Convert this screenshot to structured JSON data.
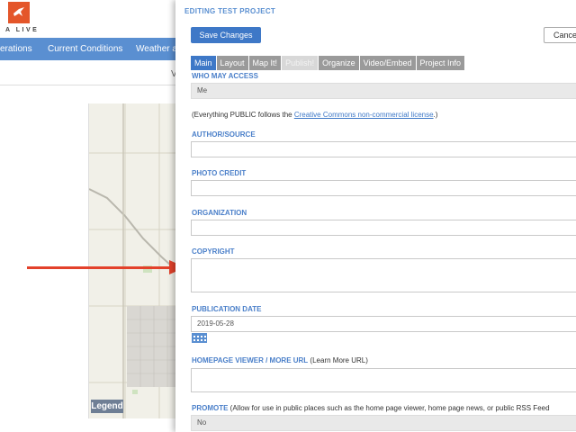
{
  "background": {
    "logo_text": "A LIVE",
    "nav": [
      "erations",
      "Current Conditions",
      "Weather a"
    ],
    "sub_text": "V",
    "legend_label": "Legend"
  },
  "panel": {
    "title": "EDITING TEST PROJECT",
    "save_label": "Save Changes",
    "cancel_label": "Cance",
    "tabs": [
      {
        "label": "Main",
        "state": "active"
      },
      {
        "label": "Layout",
        "state": "normal"
      },
      {
        "label": "Map It!",
        "state": "normal"
      },
      {
        "label": "Publish!",
        "state": "dim"
      },
      {
        "label": "Organize",
        "state": "normal"
      },
      {
        "label": "Video/Embed",
        "state": "normal"
      },
      {
        "label": "Project Info",
        "state": "normal"
      }
    ],
    "who_may_access": {
      "label": "WHO MAY ACCESS",
      "value": "Me"
    },
    "license_note": {
      "prefix": "(Everything PUBLIC follows the ",
      "link": "Creative Commons non-commercial license",
      "suffix": ".)"
    },
    "author": {
      "label": "AUTHOR/SOURCE",
      "value": ""
    },
    "photo_credit": {
      "label": "PHOTO CREDIT",
      "value": ""
    },
    "organization": {
      "label": "ORGANIZATION",
      "value": ""
    },
    "copyright": {
      "label": "COPYRIGHT",
      "value": ""
    },
    "publication_date": {
      "label": "PUBLICATION DATE",
      "value": "2019-05-28"
    },
    "homepage_viewer": {
      "label": "HOMEPAGE VIEWER / MORE URL",
      "hint": " (Learn More URL)",
      "value": ""
    },
    "promote": {
      "label": "PROMOTE",
      "hint": " (Allow for use in public places such as the home page viewer, home page news, or public RSS Feed",
      "value": "No"
    }
  },
  "colors": {
    "accent": "#3e78c7",
    "label": "#4a7fc9",
    "nav": "#5a8fd1",
    "arrow": "#e3412b",
    "logo": "#e4562a"
  }
}
